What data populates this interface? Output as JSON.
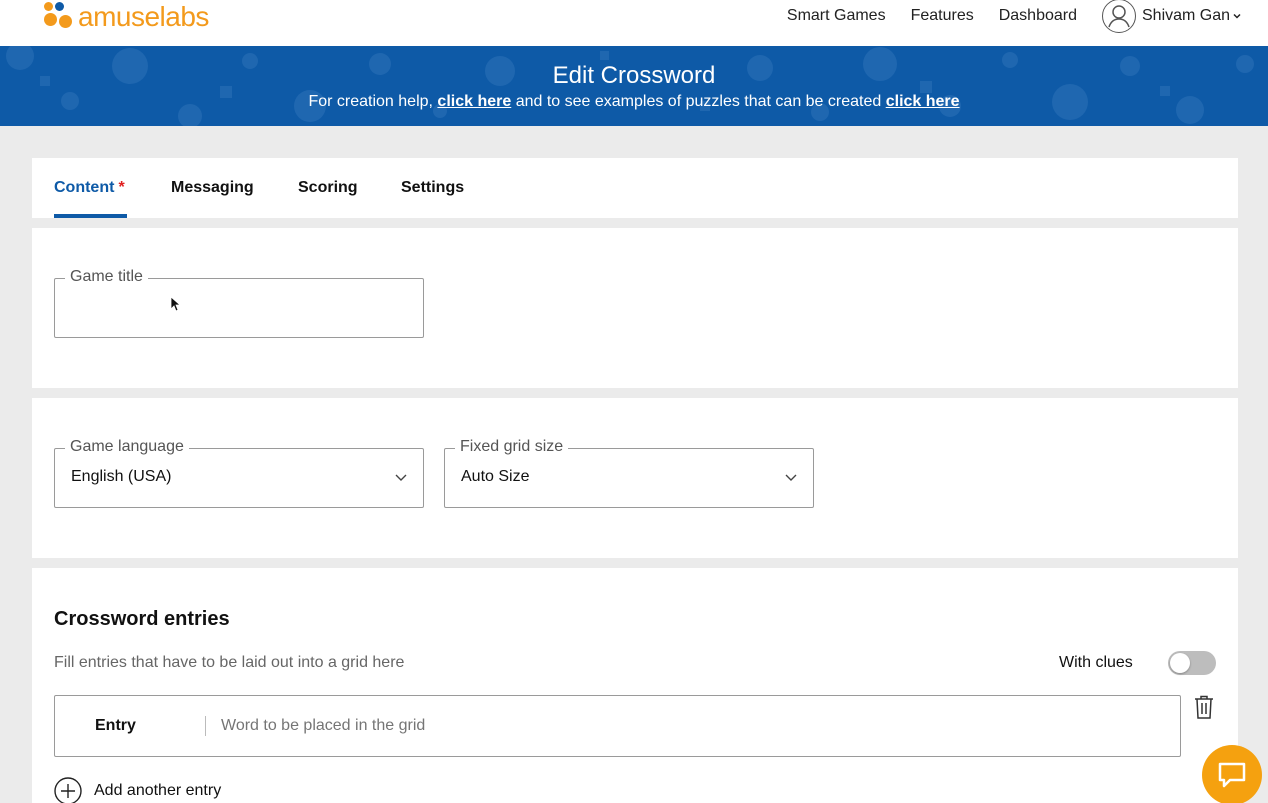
{
  "brand": {
    "logo_text": "amuselabs",
    "logo_color": "#f39a1c"
  },
  "nav": {
    "links": [
      "Smart Games",
      "Features",
      "Dashboard"
    ],
    "user_name": "Shivam Gan",
    "user_chevron": "chevron-down-icon"
  },
  "banner": {
    "title": "Edit Crossword",
    "subtitle_pre": "For creation help,",
    "link1": "click here",
    "subtitle_mid": "and to see examples of puzzles that can be created",
    "link2": "click here",
    "color": "#0e5aa7"
  },
  "tabs": [
    {
      "label": "Content",
      "required": "*",
      "active": true
    },
    {
      "label": "Messaging"
    },
    {
      "label": "Scoring"
    },
    {
      "label": "Settings"
    }
  ],
  "game_title": {
    "label": "Game title",
    "value": ""
  },
  "game_language": {
    "label": "Game language",
    "value": "English (USA)"
  },
  "grid_size": {
    "label": "Fixed grid size",
    "value": "Auto Size"
  },
  "entries": {
    "title": "Crossword entries",
    "description": "Fill entries that have to be laid out into a grid here",
    "with_clues_label": "With clues",
    "with_clues_on": false,
    "entry_label": "Entry",
    "entry_placeholder": "Word to be placed in the grid",
    "add_label": "Add another entry"
  },
  "colors": {
    "accent": "#0e5aa7",
    "required": "#e02020",
    "chat": "#f5a10f"
  }
}
